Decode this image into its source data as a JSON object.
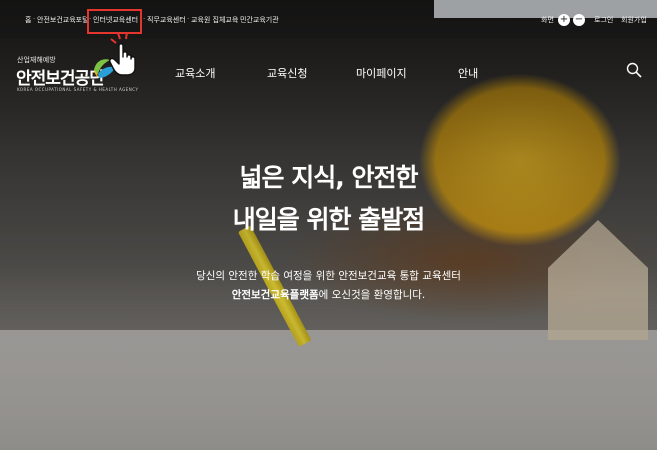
{
  "utility_nav": {
    "items": [
      "홈",
      "안전보건교육포털",
      "인터넷교육센터",
      "직무교육센터",
      "교육원 집체교육",
      "민간교육기관"
    ],
    "screen_label": "화면",
    "zoom_in": "+",
    "zoom_out": "−",
    "login": "로그인",
    "signup": "회원가입"
  },
  "logo": {
    "tagline": "산업재해예방",
    "name": "안전보건공단",
    "english": "KOREA OCCUPATIONAL SAFETY & HEALTH AGENCY"
  },
  "main_nav": {
    "items": [
      "교육소개",
      "교육신청",
      "마이페이지",
      "안내"
    ]
  },
  "hero": {
    "headline_line1": "넓은 지식, 안전한",
    "headline_line2": "내일을 위한 출발점",
    "sub_line1": "당신의 안전한 학습 여정을 위한 안전보건교육 통합 교육센터",
    "sub_line2_bold": "안전보건교육플랫폼",
    "sub_line2_rest": "에 오신것을 환영합니다."
  },
  "colors": {
    "highlight_box": "#e5352f",
    "helmet": "#f0be28"
  },
  "icons": {
    "search": "search-icon",
    "cursor": "hand-pointer-icon",
    "logo": "kosha-logo-icon"
  }
}
